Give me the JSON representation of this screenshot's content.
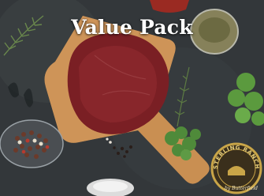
{
  "image": {
    "title": "Value Pack",
    "badge": {
      "brand_text": "STERLING RANCH",
      "byline": "by Butterfield"
    },
    "colors": {
      "background": "#34383b",
      "board": "#c98f52",
      "steak": "#7a1f24",
      "herbs": "#4f8a3a",
      "badge_gold": "#c9a548"
    }
  }
}
